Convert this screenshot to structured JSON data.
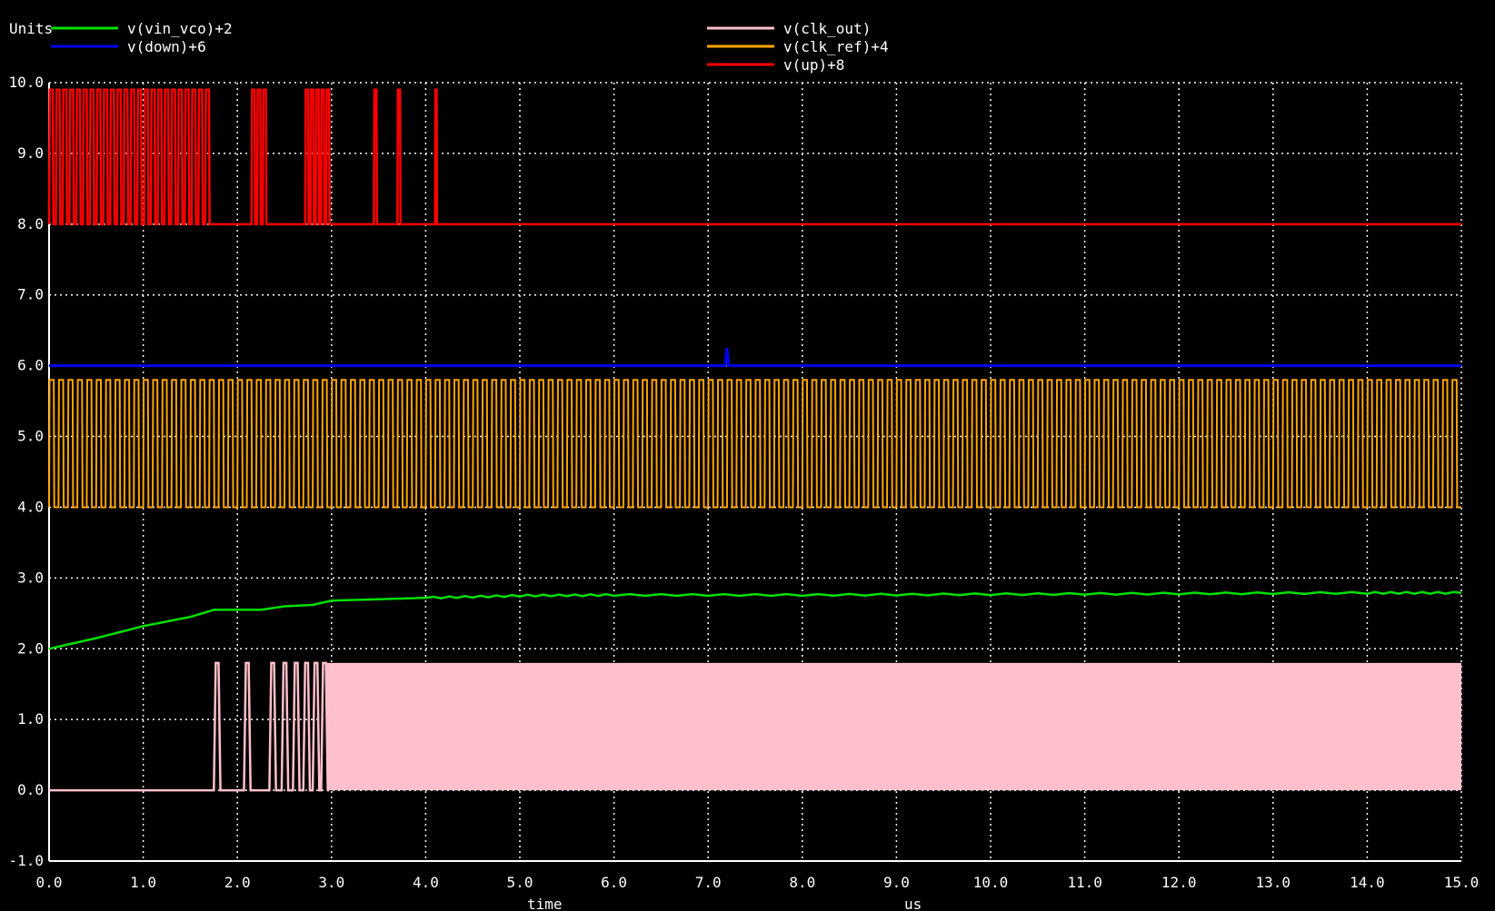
{
  "window": {
    "units_label": "Units",
    "xlabel": "time",
    "xunit": "us"
  },
  "legend": {
    "left": [
      {
        "name": "v(vin_vco)+2",
        "color": "#00e000"
      },
      {
        "name": "v(down)+6",
        "color": "#0000ee"
      }
    ],
    "right": [
      {
        "name": "v(clk_out)",
        "color": "#ffc0cb"
      },
      {
        "name": "v(clk_ref)+4",
        "color": "#ffa500"
      },
      {
        "name": "v(up)+8",
        "color": "#ff0000"
      }
    ]
  },
  "chart_data": {
    "type": "line",
    "title": "",
    "xlabel": "time",
    "xunit": "us",
    "ylabel": "Units",
    "xlim": [
      0,
      15
    ],
    "ylim": [
      -1,
      10
    ],
    "grid": true,
    "legend_position": "top",
    "xticks": [
      "0.0",
      "1.0",
      "2.0",
      "3.0",
      "4.0",
      "5.0",
      "6.0",
      "7.0",
      "8.0",
      "9.0",
      "10.0",
      "11.0",
      "12.0",
      "13.0",
      "14.0",
      "15.0"
    ],
    "yticks": [
      "-1.0",
      "0.0",
      "1.0",
      "2.0",
      "3.0",
      "4.0",
      "5.0",
      "6.0",
      "7.0",
      "8.0",
      "9.0",
      "10.0"
    ],
    "series": [
      {
        "name": "v(vin_vco)+2",
        "color": "#00e000",
        "shape": "line",
        "x": [
          0,
          0.5,
          1.0,
          1.5,
          1.75,
          2.25,
          2.5,
          2.8,
          3.0,
          3.5,
          4.0,
          5.0,
          6.0,
          8.0,
          10.0,
          12.0,
          14.0,
          15.0
        ],
        "y": [
          2.0,
          2.15,
          2.32,
          2.45,
          2.55,
          2.55,
          2.6,
          2.62,
          2.68,
          2.7,
          2.72,
          2.75,
          2.76,
          2.76,
          2.77,
          2.78,
          2.79,
          2.79
        ]
      },
      {
        "name": "v(down)+6",
        "color": "#0000ee",
        "shape": "flat-with-glitch",
        "baseline": 6.0,
        "glitch": {
          "x": 7.2,
          "peak": 6.25
        }
      },
      {
        "name": "v(clk_ref)+4",
        "color": "#ffa500",
        "shape": "square-wave",
        "low": 4.0,
        "high": 5.8,
        "x_start": 0.0,
        "x_end": 15.0,
        "cycles": 150
      },
      {
        "name": "v(up)+8",
        "color": "#ff0000",
        "shape": "pulse-bursts",
        "low": 8.0,
        "high": 9.9,
        "x_end": 15.0,
        "bursts": [
          {
            "start": 0.0,
            "end": 1.73,
            "pulses": 24
          },
          {
            "start": 2.15,
            "end": 2.33,
            "pulses": 3
          },
          {
            "start": 2.72,
            "end": 3.0,
            "pulses": 5
          },
          {
            "start": 3.45,
            "end": 3.5,
            "pulses": 1
          },
          {
            "start": 3.7,
            "end": 3.75,
            "pulses": 1
          },
          {
            "start": 4.1,
            "end": 4.13,
            "pulses": 1
          }
        ]
      },
      {
        "name": "v(clk_out)",
        "color": "#ffc0cb",
        "shape": "vco-output",
        "low": 0.0,
        "high": 1.8,
        "pulses": [
          1.78,
          2.1,
          2.37,
          2.5,
          2.62,
          2.73,
          2.83,
          2.92
        ],
        "dense_start": 2.95,
        "dense_end": 15.0
      }
    ]
  }
}
